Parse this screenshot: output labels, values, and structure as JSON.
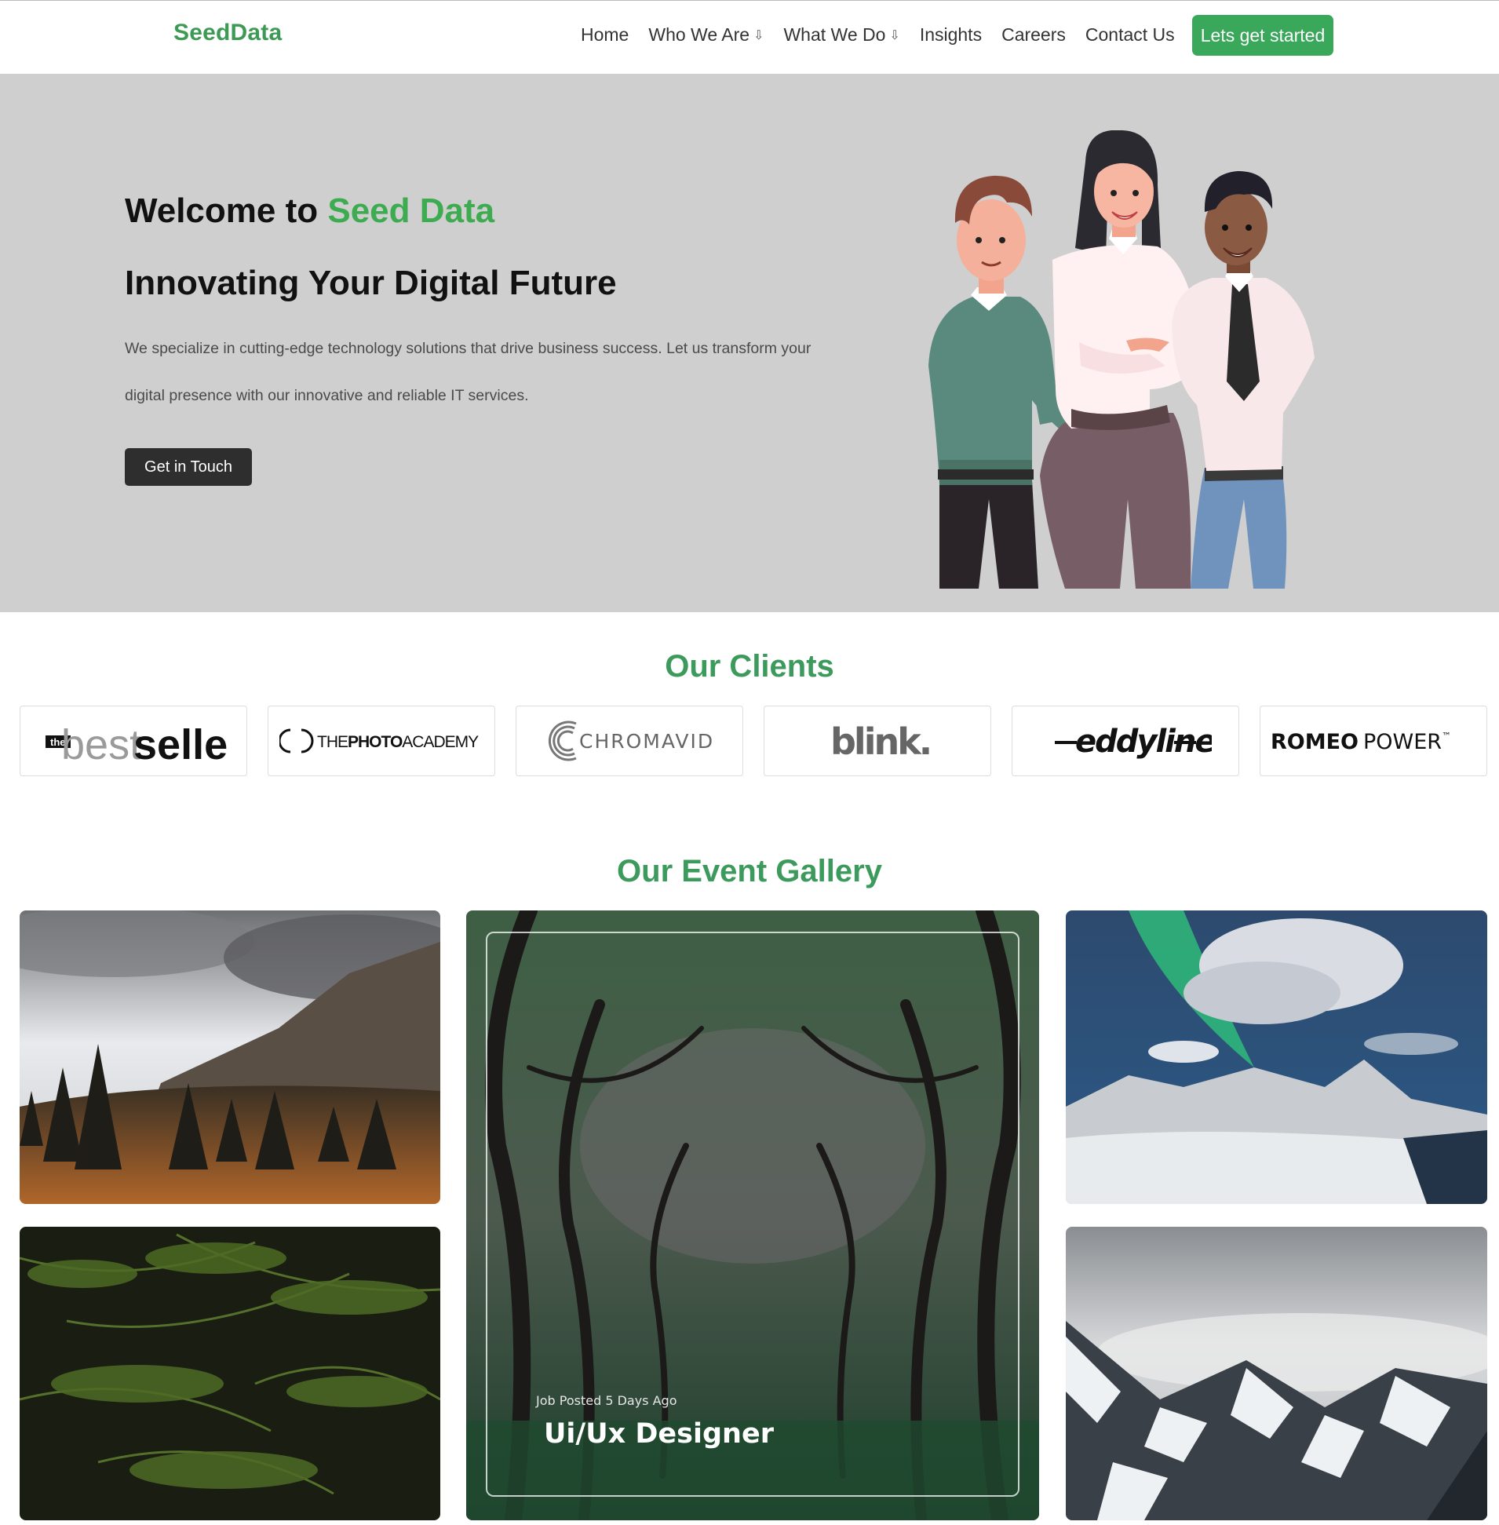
{
  "nav": {
    "brand": "SeedData",
    "links": [
      {
        "label": "Home"
      },
      {
        "label": "Who We Are",
        "arrow": "⇩"
      },
      {
        "label": "What We Do",
        "arrow": "⇩"
      },
      {
        "label": "Insights"
      },
      {
        "label": "Careers"
      },
      {
        "label": "Contact Us"
      }
    ],
    "cta": "Lets get started"
  },
  "hero": {
    "title_prefix": "Welcome to ",
    "title_accent": "Seed Data",
    "subtitle": "Innovating Your Digital Future",
    "description": "We specialize in cutting-edge technology solutions that drive business success. Let us transform your digital presence with our innovative and reliable IT services.",
    "button": "Get in Touch"
  },
  "clients": {
    "title": "Our Clients",
    "logos": [
      {
        "name": "bestseller",
        "small": "the",
        "part1": "best",
        "part2": "seller"
      },
      {
        "name": "photo-academy",
        "part1": "THE",
        "part2": "PHOTO",
        "part3": "ACADEMY"
      },
      {
        "name": "chromavid",
        "text": "CHROMAVID"
      },
      {
        "name": "blink",
        "text": "blink."
      },
      {
        "name": "eddyline",
        "text": "eddyline"
      },
      {
        "name": "romeo-power",
        "part1": "ROMEO",
        "part2": "POWER",
        "tm": "™"
      }
    ]
  },
  "gallery": {
    "title": "Our Event Gallery",
    "job_meta": "Job Posted 5 Days Ago",
    "job_title": "Ui/Ux Designer"
  },
  "colors": {
    "brand_green": "#3d9a55",
    "accent_green": "#3dab4f",
    "cta_green": "#3aa85a",
    "hero_bg": "#cfcfcf",
    "dark_button": "#2e2e2e"
  }
}
